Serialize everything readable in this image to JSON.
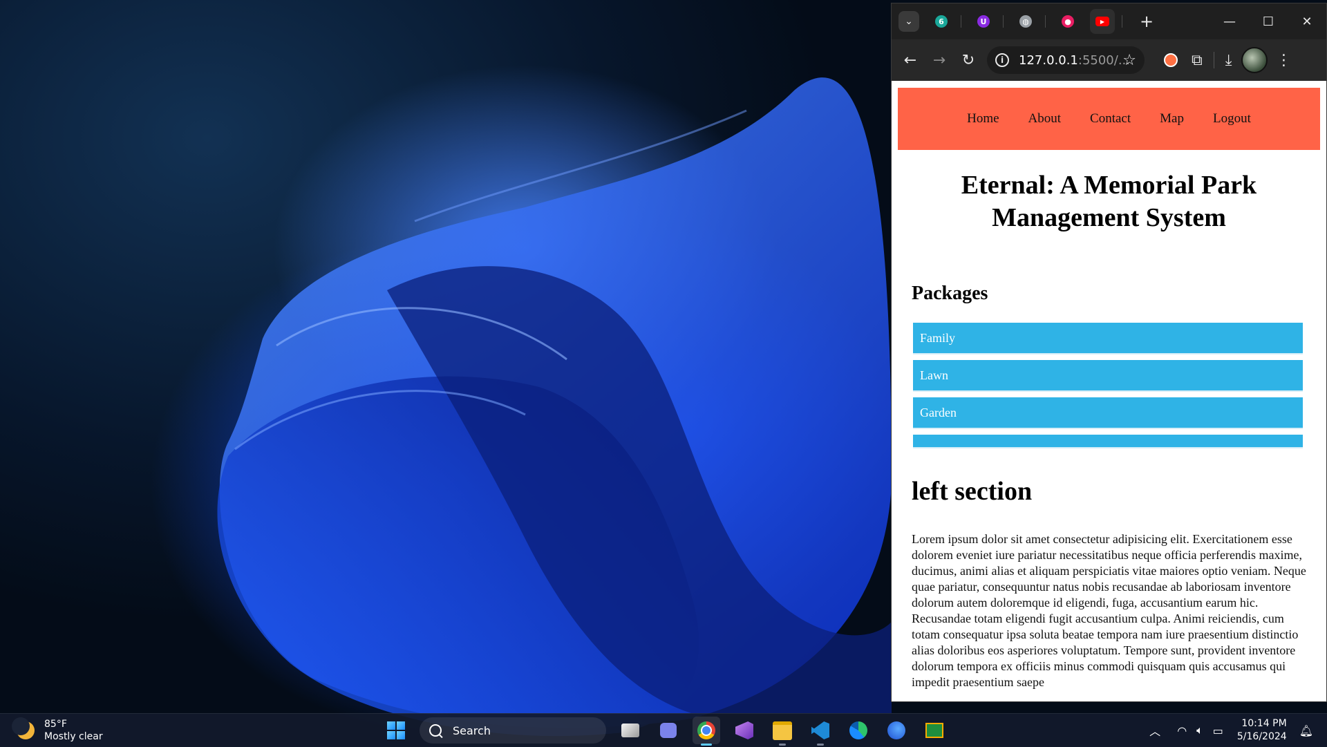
{
  "browser": {
    "tabs": [
      {
        "name": "tab-1",
        "color": "#1aa89a",
        "glyph": "6"
      },
      {
        "name": "tab-2",
        "color": "#8a2be2",
        "glyph": "U"
      },
      {
        "name": "tab-3",
        "color": "#9aa0a6",
        "glyph": "◍"
      },
      {
        "name": "tab-4",
        "color": "#e91e63",
        "glyph": "●"
      },
      {
        "name": "tab-5",
        "color": "#ff0000",
        "glyph": "▶"
      }
    ],
    "url_host": "127.0.0.1",
    "url_rest": ":5500/..."
  },
  "site": {
    "nav": [
      "Home",
      "About",
      "Contact",
      "Map",
      "Logout"
    ],
    "title": "Eternal: A Memorial Park Management System",
    "packages_heading": "Packages",
    "packages": [
      "Family",
      "Lawn",
      "Garden",
      ""
    ],
    "left_heading": "left section",
    "lorem": "Lorem ipsum dolor sit amet consectetur adipisicing elit. Exercitationem esse dolorem eveniet iure pariatur necessitatibus neque officia perferendis maxime, ducimus, animi alias et aliquam perspiciatis vitae maiores optio veniam. Neque quae pariatur, consequuntur natus nobis recusandae ab laboriosam inventore dolorum autem doloremque id eligendi, fuga, accusantium earum hic. Recusandae totam eligendi fugit accusantium culpa. Animi reiciendis, cum totam consequatur ipsa soluta beatae tempora nam iure praesentium distinctio alias doloribus eos asperiores voluptatum. Tempore sunt, provident inventore dolorum tempora ex officiis minus commodi quisquam quis accusamus qui impedit praesentium saepe"
  },
  "taskbar": {
    "weather_temp": "85°F",
    "weather_desc": "Mostly clear",
    "search_label": "Search",
    "time": "10:14 PM",
    "date": "5/16/2024"
  }
}
